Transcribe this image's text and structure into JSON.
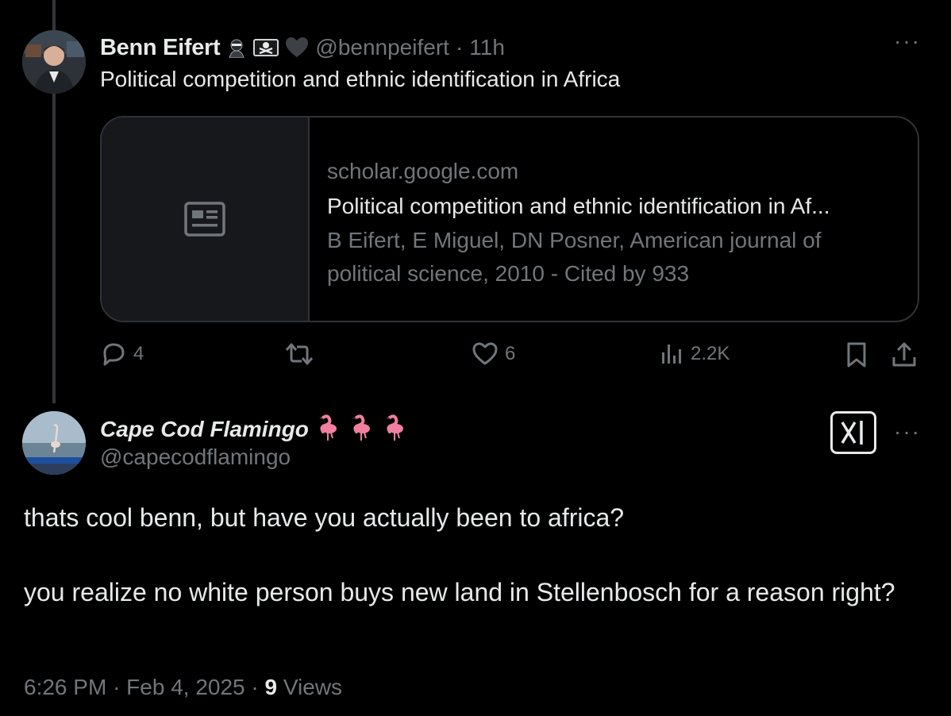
{
  "tweet1": {
    "name": "Benn Eifert",
    "handle": "@bennpeifert",
    "dot": "·",
    "time": "11h",
    "text": "Political competition and ethnic identification in Africa",
    "badges": [
      "ninja-emoji",
      "pirate-flag-emoji",
      "black-heart-emoji"
    ],
    "more": "···",
    "card": {
      "domain": "scholar.google.com",
      "title": "Political competition and ethnic identification in Af...",
      "description": "B Eifert, E Miguel, DN Posner, American journal of political science, 2010 - Cited by 933",
      "thumb_icon": "article-icon"
    },
    "actions": {
      "replies": "4",
      "retweets": "",
      "likes": "6",
      "views": "2.2K"
    }
  },
  "tweet2": {
    "name": "Cape Cod Flamingo",
    "name_emojis": [
      "flamingo-emoji",
      "flamingo-emoji",
      "flamingo-emoji"
    ],
    "handle": "@capecodflamingo",
    "more": "···",
    "text_p1": "thats cool benn, but have you actually been to africa?",
    "text_p2": "you realize no white person buys new land in Stellenbosch for a reason right?",
    "time": "6:26 PM",
    "dot": "·",
    "date": "Feb 4, 2025",
    "dot2": "·",
    "views_count": "9",
    "views_label": "Views",
    "grok_icon": "grok-icon"
  },
  "colors": {
    "background": "#000000",
    "text": "#e7e9ea",
    "muted": "#71767b",
    "border": "#2f3336"
  }
}
